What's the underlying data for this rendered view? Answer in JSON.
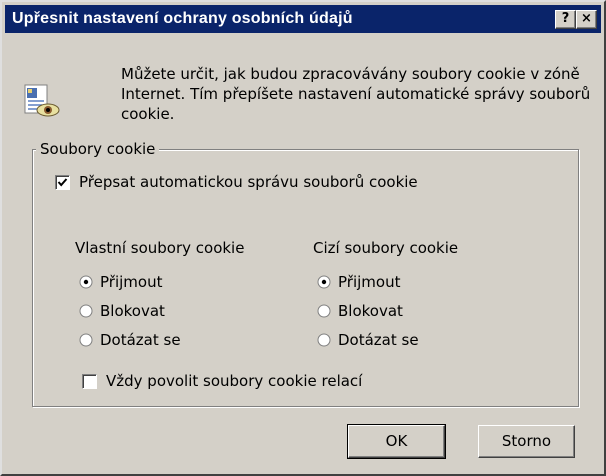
{
  "dialog": {
    "title": "Upřesnit nastavení ochrany osobních údajů",
    "help_glyph": "?",
    "close_glyph": "×"
  },
  "intro": {
    "text": "Můžete určit, jak budou zpracovávány soubory cookie v zóně Internet. Tím přepíšete nastavení automatické správy souborů cookie.",
    "icon": "privacy-settings-icon"
  },
  "cookies": {
    "legend": "Soubory cookie",
    "override": {
      "label": "Přepsat automatickou správu souborů cookie",
      "checked": true
    },
    "first_party": {
      "heading": "Vlastní soubory cookie",
      "options": [
        "Přijmout",
        "Blokovat",
        "Dotázat se"
      ],
      "selected": "Přijmout"
    },
    "third_party": {
      "heading": "Cizí soubory cookie",
      "options": [
        "Přijmout",
        "Blokovat",
        "Dotázat se"
      ],
      "selected": "Přijmout"
    },
    "session": {
      "label": "Vždy povolit soubory cookie relací",
      "checked": false
    }
  },
  "buttons": {
    "ok": "OK",
    "cancel": "Storno"
  },
  "colors": {
    "face": "#d4d0c8",
    "titlebar": "#0a246a"
  }
}
